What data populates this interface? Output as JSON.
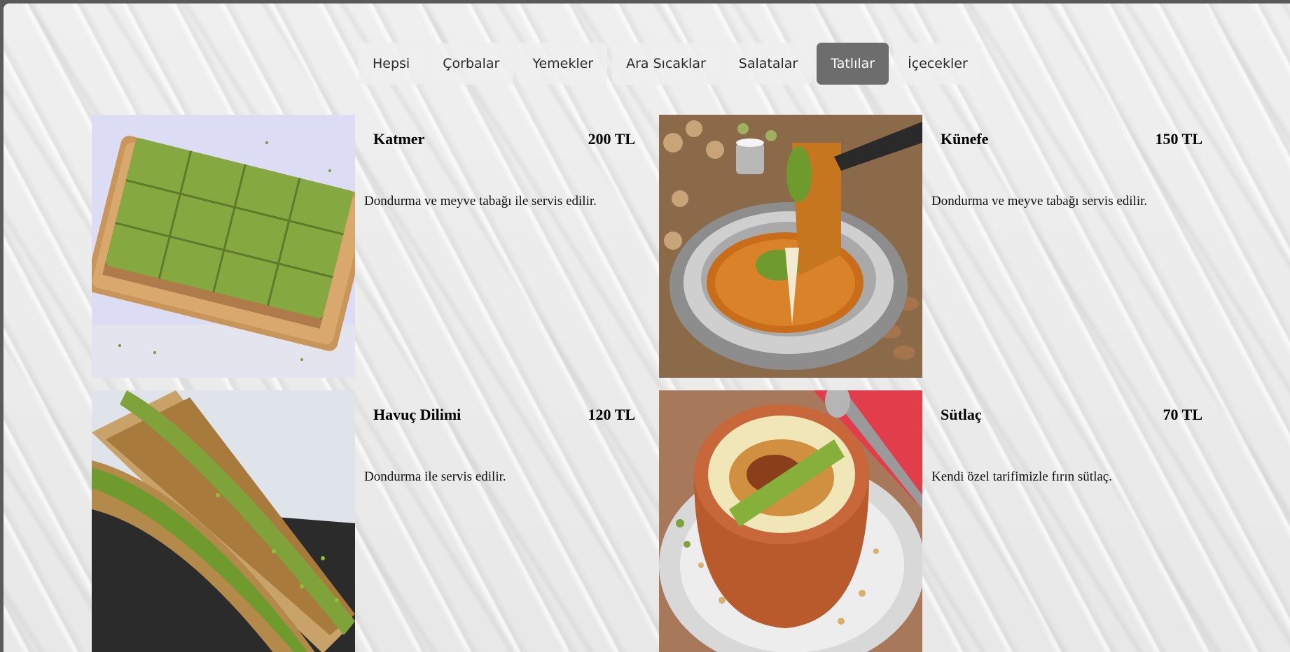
{
  "tabs": [
    {
      "label": "Hepsi"
    },
    {
      "label": "Çorbalar"
    },
    {
      "label": "Yemekler"
    },
    {
      "label": "Ara Sıcaklar"
    },
    {
      "label": "Salatalar"
    },
    {
      "label": "Tatlılar",
      "active": true
    },
    {
      "label": "İçecekler"
    }
  ],
  "items": [
    {
      "name": "Katmer",
      "price": "200 TL",
      "description": "Dondurma ve meyve tabağı ile servis edilir.",
      "image": "katmer-photo"
    },
    {
      "name": "Künefe",
      "price": "150 TL",
      "description": "Dondurma ve meyve tabağı servis edilir.",
      "image": "kunefe-photo"
    },
    {
      "name": "Havuç Dilimi",
      "price": "120 TL",
      "description": "Dondurma ile servis edilir.",
      "image": "havuc-dilimi-photo"
    },
    {
      "name": "Sütlaç",
      "price": "70 TL",
      "description": "Kendi özel tarifimizle fırın sütlaç.",
      "image": "sutlac-photo"
    }
  ],
  "colors": {
    "active_tab_bg": "#6d6d6d",
    "tab_bg": "#eeeeee",
    "pistachio": "#7fa33a"
  }
}
